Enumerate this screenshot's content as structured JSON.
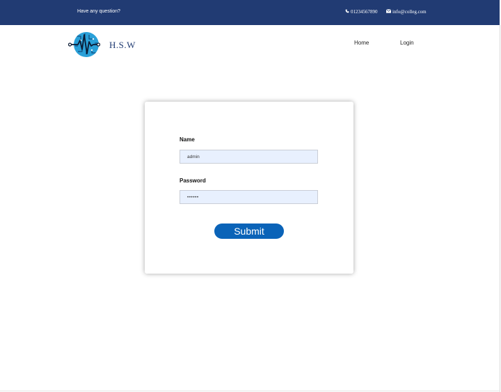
{
  "topbar": {
    "question": "Have any question?",
    "phone": "01234567890",
    "email": "info@colleg.com",
    "phone_icon": "phone-icon",
    "email_icon": "envelope-icon"
  },
  "header": {
    "brand": "H.S.W",
    "logo_icon": "heartbeat-circuit-logo",
    "nav": {
      "home": "Home",
      "login": "Login"
    }
  },
  "form": {
    "name_label": "Name",
    "name_value": "admin",
    "password_label": "Password",
    "password_value": "••••••",
    "submit_label": "Submit"
  },
  "colors": {
    "topbar_bg": "#213b73",
    "button_bg": "#0a63b8",
    "field_bg": "#e8f0fe"
  }
}
